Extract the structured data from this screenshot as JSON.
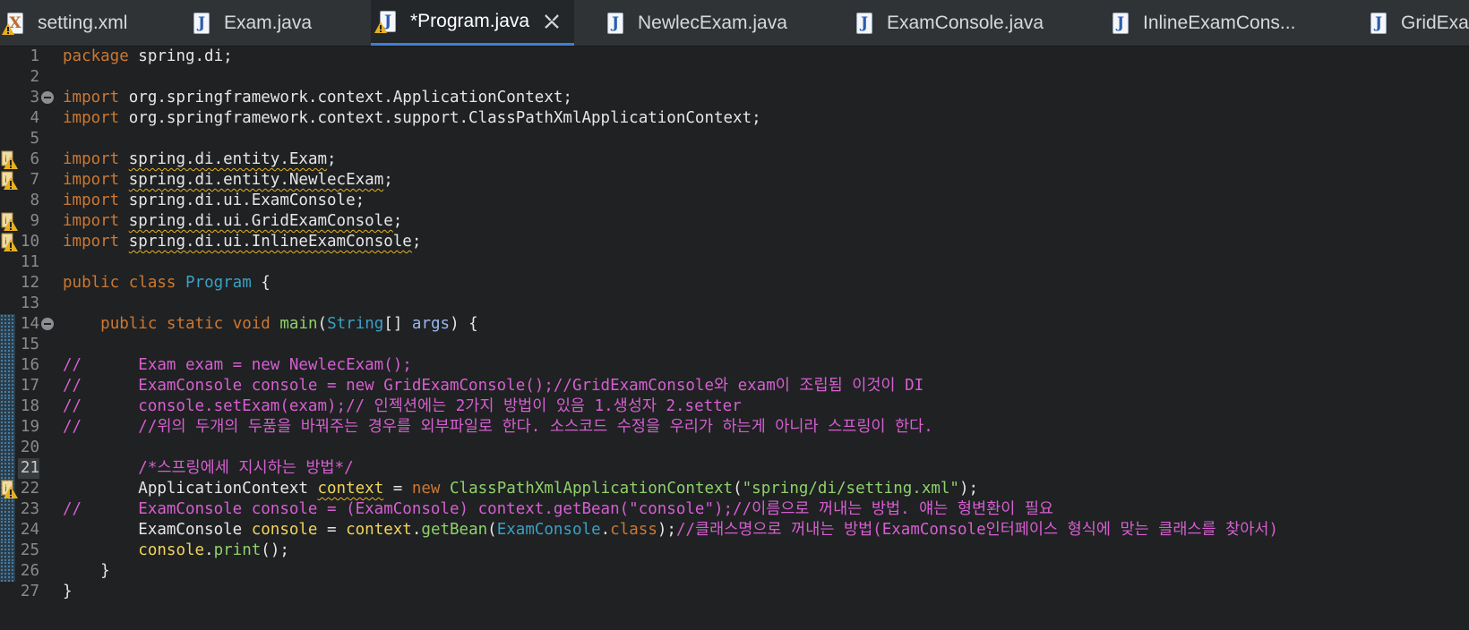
{
  "tabs": [
    {
      "label": "setting.xml",
      "icon": "xml-file-icon",
      "active": false
    },
    {
      "label": "Exam.java",
      "icon": "java-file-icon",
      "active": false
    },
    {
      "label": "*Program.java",
      "icon": "java-file-warning-icon",
      "active": true
    },
    {
      "label": "NewlecExam.java",
      "icon": "java-file-icon",
      "active": false
    },
    {
      "label": "ExamConsole.java",
      "icon": "java-file-icon",
      "active": false
    },
    {
      "label": "InlineExamCons...",
      "icon": "java-file-icon",
      "active": false
    },
    {
      "label": "GridExa",
      "icon": "java-file-icon",
      "active": false
    }
  ],
  "editor": {
    "line_numbers": [
      "1",
      "2",
      "3",
      "4",
      "5",
      "6",
      "7",
      "8",
      "9",
      "10",
      "11",
      "12",
      "13",
      "14",
      "15",
      "16",
      "17",
      "18",
      "19",
      "20",
      "21",
      "22",
      "23",
      "24",
      "25",
      "26",
      "27"
    ],
    "current_line": "21",
    "code": {
      "l1": [
        "package",
        " spring.di;"
      ],
      "l3": [
        "import",
        " org.springframework.context.ApplicationContext;"
      ],
      "l4": [
        "import",
        " org.springframework.context.support.ClassPathXmlApplicationContext;"
      ],
      "l6": [
        "import",
        " ",
        "spring.di.entity.Exam",
        ";"
      ],
      "l7": [
        "import",
        " ",
        "spring.di.entity.NewlecExam",
        ";"
      ],
      "l8": [
        "import",
        " spring.di.ui.ExamConsole;"
      ],
      "l9": [
        "import",
        " ",
        "spring.di.ui.GridExamConsole",
        ";"
      ],
      "l10": [
        "import",
        " ",
        "spring.di.ui.InlineExamConsole",
        ";"
      ],
      "l12": [
        "public",
        " ",
        "class",
        " ",
        "Program",
        " {"
      ],
      "l14": [
        "    ",
        "public",
        " ",
        "static",
        " ",
        "void",
        " ",
        "main",
        "(",
        "String",
        "[] ",
        "args",
        ") {"
      ],
      "l16": "//      Exam exam = new NewlecExam();",
      "l17": "//      ExamConsole console = new GridExamConsole();//GridExamConsole와 exam이 조립됨 이것이 DI",
      "l18": "//      console.setExam(exam);// 인젝션에는 2가지 방법이 있음 1.생성자 2.setter",
      "l19": "//      //위의 두개의 두품을 바꿔주는 경우를 외부파일로 한다. 소스코드 수정을 우리가 하는게 아니라 스프링이 한다.",
      "l21": "        /*스프링에세 지시하는 방법*/",
      "l22": [
        "        ApplicationContext ",
        "context",
        " = ",
        "new",
        " ",
        "ClassPathXmlApplicationContext",
        "(",
        "\"spring/di/setting.xml\"",
        ");"
      ],
      "l23": "//      ExamConsole console = (ExamConsole) context.getBean(\"console\");//이름으로 꺼내는 방법. 얘는 형변환이 필요",
      "l24": [
        "        ExamConsole ",
        "console",
        " = ",
        "context",
        ".",
        "getBean",
        "(",
        "ExamConsole",
        ".",
        "class",
        ");",
        "//클래스명으로 꺼내는 방법(ExamConsole인터페이스 형식에 맞는 클래스를 찾아서)"
      ],
      "l25": [
        "        ",
        "console",
        ".",
        "print",
        "();"
      ],
      "l26": "    }",
      "l27": "}"
    },
    "colors": {
      "background": "#1f2123",
      "keyword": "#cc7832",
      "comment": "#d65fd0",
      "string": "#8fd16a",
      "type": "#3ba0c4",
      "field": "#f0d45c"
    }
  }
}
